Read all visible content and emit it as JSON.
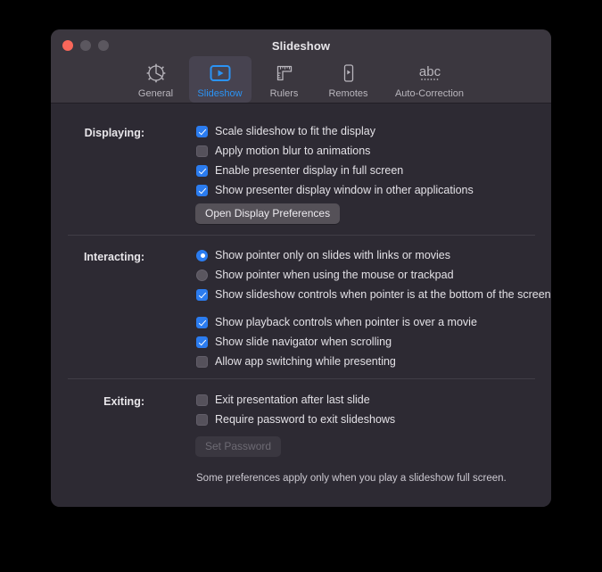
{
  "window": {
    "title": "Slideshow",
    "traffic_lights": [
      "close-button",
      "minimize-button",
      "maximize-button"
    ]
  },
  "toolbar": {
    "items": [
      {
        "label": "General",
        "icon": "gear-icon",
        "selected": false
      },
      {
        "label": "Slideshow",
        "icon": "play-rect-icon",
        "selected": true
      },
      {
        "label": "Rulers",
        "icon": "ruler-icon",
        "selected": false
      },
      {
        "label": "Remotes",
        "icon": "remote-device-icon",
        "selected": false
      },
      {
        "label": "Auto-Correction",
        "icon": "abc-spellcheck-icon",
        "selected": false
      }
    ]
  },
  "sections": {
    "displaying": {
      "label": "Displaying:",
      "options": [
        {
          "label": "Scale slideshow to fit the display",
          "type": "checkbox",
          "checked": true
        },
        {
          "label": "Apply motion blur to animations",
          "type": "checkbox",
          "checked": false
        },
        {
          "label": "Enable presenter display in full screen",
          "type": "checkbox",
          "checked": true
        },
        {
          "label": "Show presenter display window in other applications",
          "type": "checkbox",
          "checked": true
        }
      ],
      "button": {
        "label": "Open Display Preferences",
        "disabled": false
      }
    },
    "interacting": {
      "label": "Interacting:",
      "radios": [
        {
          "label": "Show pointer only on slides with links or movies",
          "type": "radio",
          "selected": true
        },
        {
          "label": "Show pointer when using the mouse or trackpad",
          "type": "radio",
          "selected": false
        }
      ],
      "options": [
        {
          "label": "Show slideshow controls when pointer is at the bottom of the screen",
          "type": "checkbox",
          "checked": true
        },
        {
          "label": "Show playback controls when pointer is over a movie",
          "type": "checkbox",
          "checked": true
        },
        {
          "label": "Show slide navigator when scrolling",
          "type": "checkbox",
          "checked": true
        },
        {
          "label": "Allow app switching while presenting",
          "type": "checkbox",
          "checked": false
        }
      ]
    },
    "exiting": {
      "label": "Exiting:",
      "options": [
        {
          "label": "Exit presentation after last slide",
          "type": "checkbox",
          "checked": false
        },
        {
          "label": "Require password to exit slideshows",
          "type": "checkbox",
          "checked": false
        }
      ],
      "button": {
        "label": "Set Password",
        "disabled": true
      }
    }
  },
  "footnote": "Some preferences apply only when you play a slideshow full screen.",
  "colors": {
    "window_bg": "#2d2a33",
    "toolbar_bg": "#3b373f",
    "accent_blue": "#2b7cf0",
    "tab_blue": "#2b93f4",
    "close_red": "#f9675a",
    "text": "#e3e1e6",
    "divider": "#403d46"
  }
}
